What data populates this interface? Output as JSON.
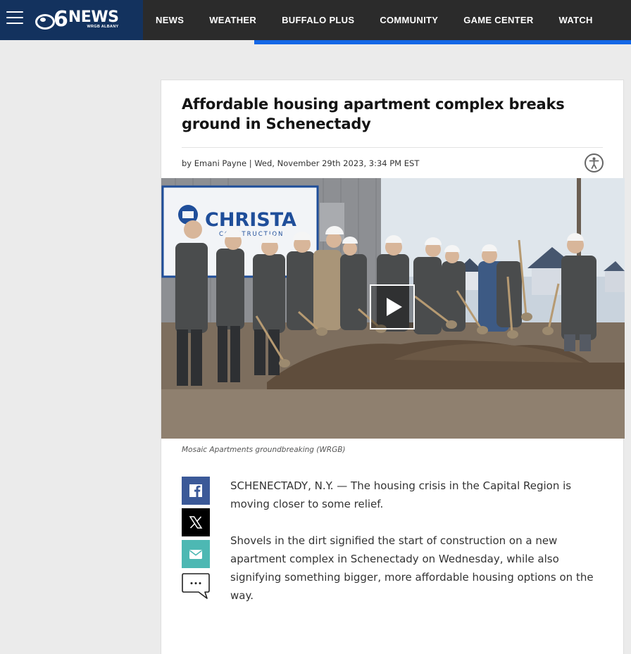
{
  "header": {
    "logo_number": "6",
    "logo_text": "NEWS",
    "logo_subtext": "WRGB ALBANY",
    "nav": [
      "NEWS",
      "WEATHER",
      "BUFFALO PLUS",
      "COMMUNITY",
      "GAME CENTER",
      "WATCH"
    ]
  },
  "article": {
    "headline": "Affordable housing apartment complex breaks ground in Schenectady",
    "byline": "by Emani Payne | Wed, November 29th 2023, 3:34 PM EST",
    "sign_text": "CHRISTA",
    "sign_subtext": "CONSTRUCTION",
    "caption": "Mosaic Apartments groundbreaking (WRGB)",
    "paragraphs": [
      "SCHENECTADY, N.Y. — The housing crisis in the Capital Region is moving closer to some relief.",
      "Shovels in the dirt signified the start of construction on a new apartment complex in Schenectady on Wednesday, while also signifying something bigger, more affordable housing options on the way."
    ]
  },
  "icons": {
    "menu": "hamburger-icon",
    "accessibility": "accessibility-icon",
    "play": "play-icon",
    "facebook": "facebook-icon",
    "x": "x-icon",
    "email": "email-icon",
    "comment": "comment-icon"
  },
  "colors": {
    "brand_blue": "#13325e",
    "topbar": "#2b2b2b",
    "accent_blue": "#1467e6",
    "facebook": "#3b5998",
    "email": "#4db8b3"
  }
}
